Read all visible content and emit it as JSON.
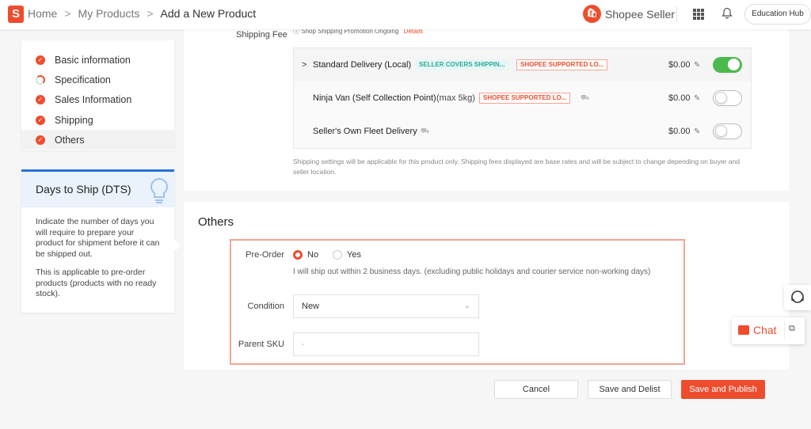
{
  "breadcrumb": {
    "home": "Home",
    "products": "My Products",
    "current": "Add a New Product",
    "sep": ">"
  },
  "header": {
    "seller_label": "Shopee Seller",
    "education_hub": "Education Hub",
    "logo_letter": "S"
  },
  "nav": {
    "items": [
      {
        "label": "Basic information",
        "status": "done"
      },
      {
        "label": "Specification",
        "status": "partial"
      },
      {
        "label": "Sales Information",
        "status": "done"
      },
      {
        "label": "Shipping",
        "status": "done"
      },
      {
        "label": "Others",
        "status": "done",
        "active": true
      }
    ]
  },
  "dts": {
    "title": "Days to Ship (DTS)",
    "para1": "Indicate the number of days you will require to prepare your product for shipment before it can be shipped out.",
    "para2": "This is applicable to pre-order products (products with no ready stock)."
  },
  "shipping": {
    "label": "Shipping Fee",
    "promo": "Shop Shipping Promotion Ongoing",
    "promo_link": "Details",
    "rows": [
      {
        "name": "Standard Delivery (Local)",
        "tags": [
          "SELLER COVERS SHIPPIN...",
          "SHOPEE SUPPORTED LO..."
        ],
        "fee": "$0.00",
        "enabled": true
      },
      {
        "name": "Ninja Van (Self Collection Point)",
        "note": "(max 5kg)",
        "tags": [
          "SHOPEE SUPPORTED LO..."
        ],
        "fee": "$0.00",
        "enabled": false
      },
      {
        "name": "Seller's Own Fleet Delivery",
        "tags": [],
        "fee": "$0.00",
        "enabled": false
      }
    ],
    "note": "Shipping settings will be applicable for this product only. Shipping fees displayed are base rates and will be subject to change depending on buyer and seller location."
  },
  "others": {
    "title": "Others",
    "preorder_label": "Pre-Order",
    "preorder_no": "No",
    "preorder_yes": "Yes",
    "preorder_value": "No",
    "preorder_hint": "I will ship out within 2 business days. (excluding public holidays and courier service non-working days)",
    "condition_label": "Condition",
    "condition_value": "New",
    "sku_label": "Parent SKU",
    "sku_placeholder": "-"
  },
  "actions": {
    "cancel": "Cancel",
    "delist": "Save and Delist",
    "publish": "Save and Publish"
  },
  "chat": {
    "label": "Chat"
  },
  "colors": {
    "brand": "#ee4d2d",
    "toggle_on": "#4cb94f",
    "teal_tag": "#26aa99",
    "dts_accent": "#2673dd"
  }
}
